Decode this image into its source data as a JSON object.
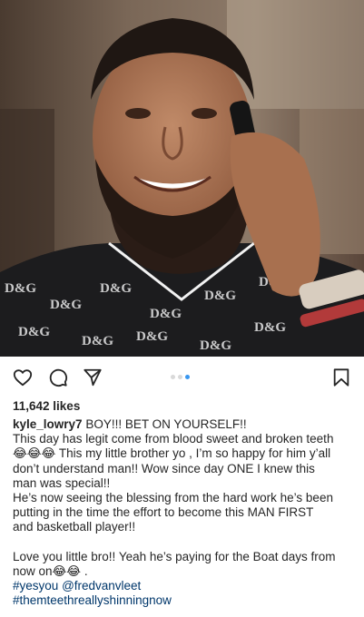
{
  "post": {
    "likes": "11,642 likes",
    "username": "kyle_lowry7",
    "caption_lines": [
      " BOY!!! BET ON YOURSELF!!",
      "This day has legit come from blood sweet and broken teeth",
      "😂😂😂 This my little brother yo , I’m so happy for him y’all",
      "don’t understand man!! Wow since day ONE I knew this",
      "man was special!!",
      "He’s now seeing the blessing from the hard work he’s been",
      "putting in the time the effort to become this MAN FIRST",
      "and basketball player!!",
      "Love you little bro!! Yeah he’s paying for the Boat days from",
      "now on😂😂 ."
    ],
    "hashtags_line": "#yesyou",
    "mention": "@fredvanvleet",
    "hashtag2": "#themteethreallyshinningnow"
  },
  "carousel": {
    "count": 3,
    "active_index": 2
  },
  "icons": {
    "like": "heart-icon",
    "comment": "comment-icon",
    "share": "paper-plane-icon",
    "save": "bookmark-icon"
  },
  "colors": {
    "text": "#262626",
    "link": "#00376b",
    "active_dot": "#3897f0",
    "inactive_dot": "#d9d9d9"
  }
}
